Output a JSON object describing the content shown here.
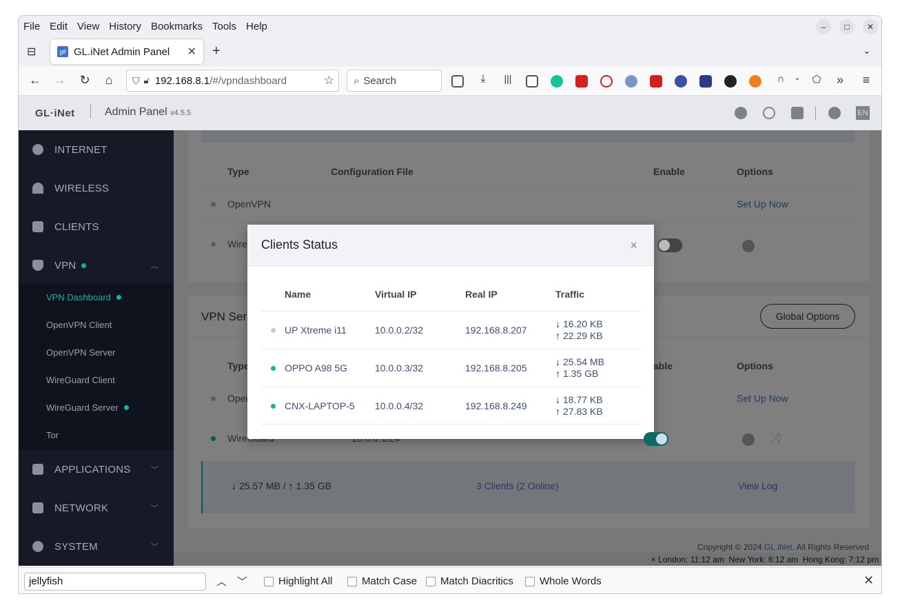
{
  "menu": [
    "File",
    "Edit",
    "View",
    "History",
    "Bookmarks",
    "Tools",
    "Help"
  ],
  "tab": {
    "title": "GL.iNet Admin Panel",
    "favicon": "gli"
  },
  "address": {
    "host": "192.168.8.1",
    "path": "/#/vpndashboard"
  },
  "search_placeholder": "Search",
  "app": {
    "logo": "GL·iNet",
    "name": "Admin Panel",
    "version": "v4.5.5",
    "lang": "EN"
  },
  "sidebar": {
    "items": [
      {
        "label": "INTERNET"
      },
      {
        "label": "WIRELESS"
      },
      {
        "label": "CLIENTS"
      },
      {
        "label": "VPN"
      }
    ],
    "vpn_sub": [
      "VPN Dashboard",
      "OpenVPN Client",
      "OpenVPN Server",
      "WireGuard Client",
      "WireGuard Server",
      "Tor"
    ],
    "bottom_items": [
      {
        "label": "APPLICATIONS"
      },
      {
        "label": "NETWORK"
      },
      {
        "label": "SYSTEM"
      }
    ]
  },
  "client_table": {
    "headers": {
      "type": "Type",
      "config": "Configuration File",
      "enable": "Enable",
      "options": "Options"
    },
    "rows": [
      {
        "type": "OpenVPN",
        "action": "Set Up Now"
      },
      {
        "type": "Wire"
      }
    ]
  },
  "server_section": {
    "title": "VPN Ser",
    "global_options": "Global Options",
    "headers": {
      "type": "Type",
      "enable": "able",
      "options": "Options"
    },
    "rows": [
      {
        "type": "Oper",
        "action": "Set Up Now"
      },
      {
        "type": "WireGuard",
        "ip": "10.0.0.1/24"
      }
    ],
    "summary": {
      "down": "25.57 MB",
      "up": "1.35 GB",
      "clients": "3 Clients (2 Online)",
      "log": "View Log"
    }
  },
  "footer": {
    "copyright_pre": "Copyright © 2024",
    "brand": "GL.iNet",
    "copyright_post": ". All Rights Reserved",
    "clocks": "× London: 11:12 am  New York: 6:12 am  Hong Kong: 7:12 pm"
  },
  "modal": {
    "title": "Clients Status",
    "close": "×",
    "headers": {
      "name": "Name",
      "vip": "Virtual IP",
      "rip": "Real IP",
      "traffic": "Traffic"
    },
    "rows": [
      {
        "name": "UP Xtreme i11",
        "vip": "10.0.0.2/32",
        "rip": "192.168.8.207",
        "down": "16.20 KB",
        "up": "22.29 KB",
        "online": false
      },
      {
        "name": "OPPO A98 5G",
        "vip": "10.0.0.3/32",
        "rip": "192.168.8.205",
        "down": "25.54 MB",
        "up": "1.35 GB",
        "online": true
      },
      {
        "name": "CNX-LAPTOP-5",
        "vip": "10.0.0.4/32",
        "rip": "192.168.8.249",
        "down": "18.77 KB",
        "up": "27.83 KB",
        "online": true
      }
    ]
  },
  "find": {
    "value": "jellyfish",
    "highlight_all": "Highlight All",
    "match_case": "Match Case",
    "match_diacritics": "Match Diacritics",
    "whole_words": "Whole Words"
  },
  "colors": {
    "accent": "#15b3a0",
    "sidebar": "#151a26",
    "link": "#4a6fc7"
  }
}
